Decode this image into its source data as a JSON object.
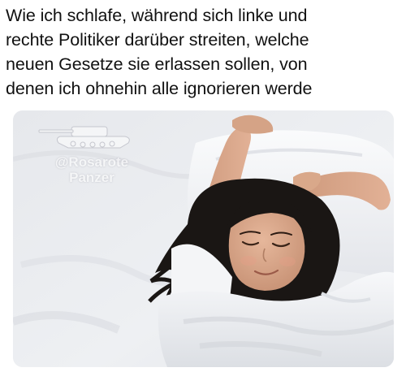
{
  "caption": {
    "lines": [
      "Wie ich schlafe, während sich linke und",
      "rechte Politiker darüber streiten, welche",
      "neuen Gesetze sie erlassen sollen, von",
      "denen ich ohnehin alle ignorieren werde"
    ]
  },
  "photo": {
    "subject": "woman-sleeping-in-white-bed",
    "watermark": {
      "line1": "@Rosarote",
      "line2": "Panzer",
      "icon": "tank-icon"
    }
  },
  "colors": {
    "text": "#111111",
    "sheets": "#f2f3f5",
    "hair": "#1a1614",
    "skin": "#d9a88a"
  }
}
